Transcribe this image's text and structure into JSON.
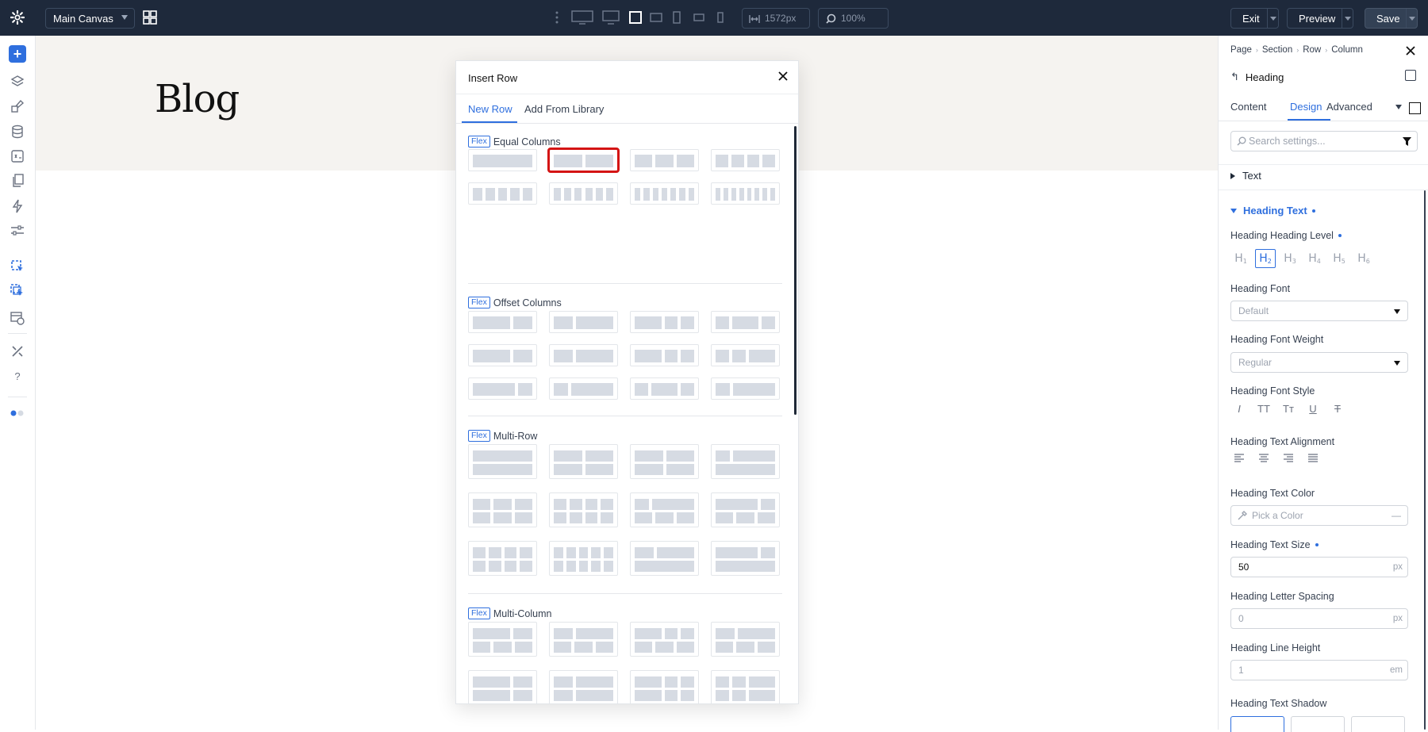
{
  "topbar": {
    "canvas_label": "Main Canvas",
    "width_value": "1572px",
    "zoom_value": "100%",
    "exit_label": "Exit",
    "preview_label": "Preview",
    "save_label": "Save"
  },
  "page": {
    "heading": "Blog"
  },
  "modal": {
    "title": "Insert Row",
    "tabs": [
      "New Row",
      "Add From Library"
    ],
    "badge": "Flex",
    "sections": [
      "Equal Columns",
      "Offset Columns",
      "Multi-Row",
      "Multi-Column"
    ]
  },
  "panel": {
    "breadcrumb": [
      "Page",
      "Section",
      "Row",
      "Column"
    ],
    "element": "Heading",
    "tabs": [
      "Content",
      "Design",
      "Advanced"
    ],
    "search_placeholder": "Search settings...",
    "groups": {
      "text": "Text",
      "heading_text": "Heading Text"
    },
    "labels": {
      "level": "Heading Heading Level",
      "font": "Heading Font",
      "weight": "Heading Font Weight",
      "style": "Heading Font Style",
      "align": "Heading Text Alignment",
      "color": "Heading Text Color",
      "size": "Heading Text Size",
      "spacing": "Heading Letter Spacing",
      "line_height": "Heading Line Height",
      "shadow": "Heading Text Shadow"
    },
    "heading_levels": [
      "H",
      "H",
      "H",
      "H",
      "H",
      "H"
    ],
    "heading_level_nums": [
      "1",
      "2",
      "3",
      "4",
      "5",
      "6"
    ],
    "font_value": "Default",
    "weight_value": "Regular",
    "style_icons": [
      "I",
      "TT",
      "Tт",
      "U",
      "T"
    ],
    "color_placeholder": "Pick a Color",
    "color_dash": "—",
    "size_value": "50",
    "size_unit": "px",
    "spacing_value": "0",
    "spacing_unit": "px",
    "line_height_value": "1",
    "line_height_unit": "em"
  },
  "colors": {
    "topbar_bg": "#1e293b",
    "accent": "#2f6fde",
    "highlight": "#d41414",
    "tile_block": "#d6dbe3",
    "hero_bg": "#f5f3f0"
  }
}
